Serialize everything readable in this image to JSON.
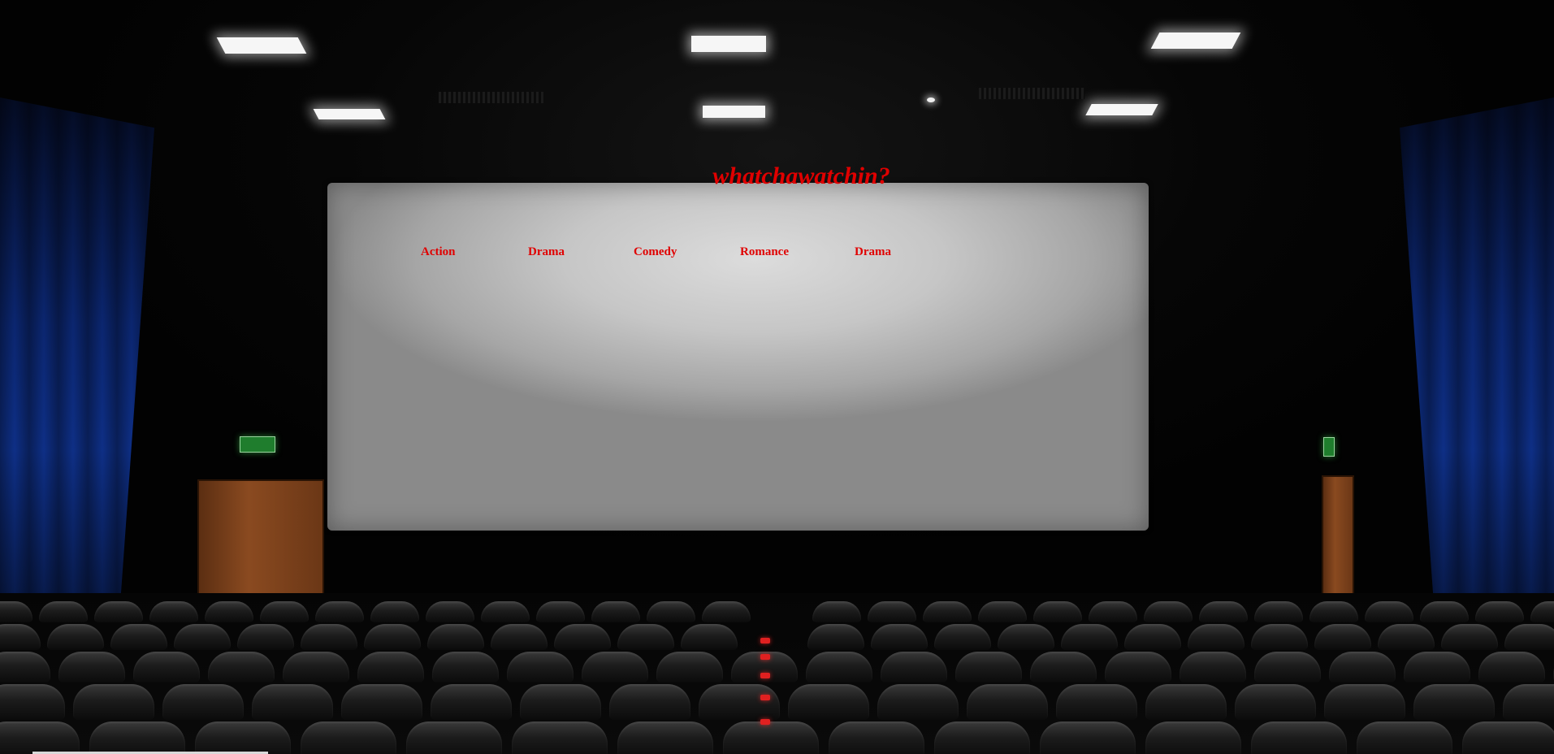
{
  "site": {
    "title": "whatchawatchin?"
  },
  "nav": {
    "genres": [
      {
        "label": "Action"
      },
      {
        "label": "Drama"
      },
      {
        "label": "Comedy"
      },
      {
        "label": "Romance"
      },
      {
        "label": "Drama"
      }
    ]
  },
  "colors": {
    "accent": "#e00000",
    "screen": "#c6c6c6",
    "curtain": "#0e2f86"
  }
}
